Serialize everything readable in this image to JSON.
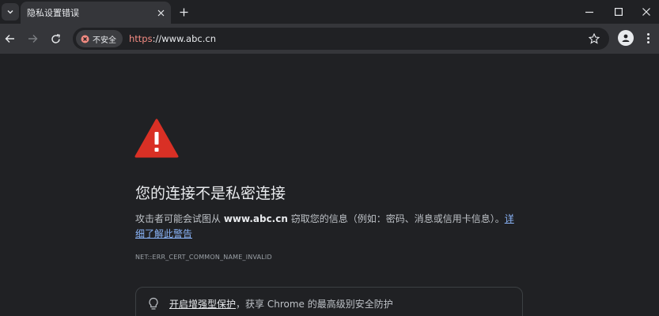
{
  "tab": {
    "title": "隐私设置错误"
  },
  "toolbar": {
    "security_label": "不安全",
    "url_scheme": "https",
    "url_rest": "://www.abc.cn"
  },
  "page": {
    "heading": "您的连接不是私密连接",
    "para_prefix": "攻击者可能会试图从 ",
    "para_domain": "www.abc.cn",
    "para_middle": " 窃取您的信息（例如：密码、消息或信用卡信息）。",
    "para_link": "详细了解此警告",
    "error_code": "NET::ERR_CERT_COMMON_NAME_INVALID",
    "promo_link": "开启增强型保护",
    "promo_text": "，获享 Chrome 的最高级别安全防护"
  },
  "colors": {
    "warning_red": "#d93025",
    "link_blue": "#8ab4f8",
    "insecure_red": "#f28b82"
  },
  "icons": [
    "tab-list-icon",
    "close-icon",
    "plus-icon",
    "minimize-icon",
    "maximize-icon",
    "window-close-icon",
    "back-icon",
    "forward-icon",
    "reload-icon",
    "insecure-icon",
    "star-icon",
    "profile-icon",
    "more-menu-icon",
    "warning-icon",
    "lightbulb-icon"
  ]
}
